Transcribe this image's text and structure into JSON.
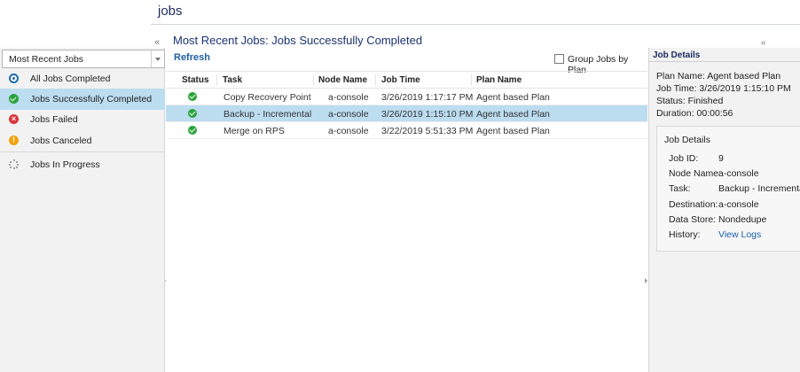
{
  "header": {
    "page_tab": "jobs",
    "main_title": "Most Recent Jobs: Jobs Successfully Completed",
    "collapse_left_glyph": "«",
    "collapse_right_glyph": "«"
  },
  "sidebar": {
    "filter": {
      "selected": "Most Recent Jobs"
    },
    "items": [
      {
        "label": "All Jobs Completed",
        "icon": "target-icon"
      },
      {
        "label": "Jobs Successfully Completed",
        "icon": "check-circle-icon",
        "selected": true
      },
      {
        "label": "Jobs Failed",
        "icon": "error-circle-icon",
        "glyph": "×"
      },
      {
        "label": "Jobs Canceled",
        "icon": "warning-circle-icon",
        "glyph": "!"
      },
      {
        "label": "Jobs In Progress",
        "icon": "spinner-icon"
      }
    ]
  },
  "toolbar": {
    "refresh_label": "Refresh",
    "group_by_plan_label": "Group Jobs by Plan"
  },
  "table": {
    "columns": [
      "Status",
      "Task",
      "Node Name",
      "Job Time",
      "Plan Name"
    ],
    "rows": [
      {
        "status": "success",
        "task": "Copy Recovery Point",
        "node": "a-console",
        "time": "3/26/2019 1:17:17 PM",
        "plan": "Agent based Plan"
      },
      {
        "status": "success",
        "task": "Backup - Incremental",
        "node": "a-console",
        "time": "3/26/2019 1:15:10 PM",
        "plan": "Agent based Plan",
        "selected": true
      },
      {
        "status": "success",
        "task": "Merge on RPS",
        "node": "a-console",
        "time": "3/22/2019 5:51:33 PM",
        "plan": "Agent based Plan"
      }
    ]
  },
  "details": {
    "header": "Job Details",
    "summary": {
      "plan": "Plan Name: Agent based Plan",
      "time": "Job Time: 3/26/2019 1:15:10 PM",
      "status": "Status: Finished",
      "duration": "Duration: 00:00:56"
    },
    "box_title": "Job Details",
    "fields": {
      "job_id": {
        "key": "Job ID:",
        "value": "9"
      },
      "node": {
        "key": "Node Name:",
        "value": "a-console"
      },
      "task": {
        "key": "Task:",
        "value": "Backup - Incremental"
      },
      "destination": {
        "key": "Destination:",
        "value": "a-console"
      },
      "data_store": {
        "key": "Data Store:",
        "value": "Nondedupe"
      },
      "history": {
        "key": "History:",
        "value": "View Logs"
      }
    }
  },
  "colors": {
    "accent": "#1d5fa8",
    "selection": "#bcdcf0",
    "success": "#2aa33b",
    "error": "#d9363a",
    "warning": "#f0a20f"
  }
}
